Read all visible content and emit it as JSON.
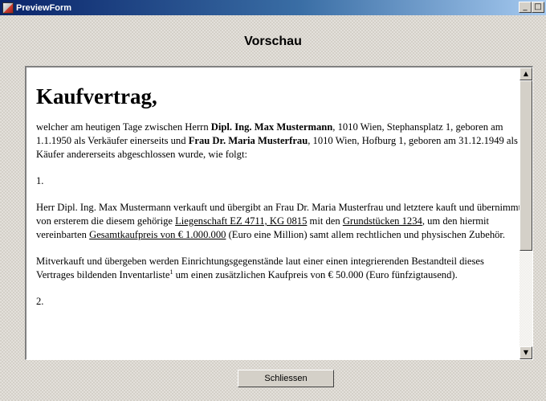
{
  "window": {
    "title": "PreviewForm",
    "controls": {
      "minimize": "_",
      "maximize": "□"
    }
  },
  "page": {
    "title": "Vorschau"
  },
  "document": {
    "heading": "Kaufvertrag,",
    "p1": {
      "a": "welcher am heutigen Tage zwischen Herrn ",
      "b": "Dipl. Ing. Max Mustermann",
      "c": ", 1010 Wien, Stephansplatz 1, geboren am 1.1.1950 als Verkäufer einerseits und ",
      "d": "Frau Dr. Maria Musterfrau",
      "e": ", 1010 Wien, Hofburg 1, geboren am 31.12.1949 als Käufer andererseits abgeschlossen wurde, wie folgt:"
    },
    "num1": "1.",
    "p2": {
      "a": "Herr Dipl. Ing. Max Mustermann verkauft und übergibt an Frau Dr. Maria Musterfrau und letztere kauft und übernimmt von ersterem die diesem gehörige ",
      "b": "Liegenschaft EZ 4711, KG 0815",
      "c": " mit den ",
      "d": "Grundstücken 1234",
      "e": ", um den hiermit vereinbarten ",
      "f": "Gesamtkaufpreis von € 1.000.000",
      "g": " (Euro eine Million) samt allem rechtlichen und physischen Zubehör."
    },
    "p3": {
      "a": "Mitverkauft und übergeben werden Einrichtungsgegenstände laut einer einen integrierenden Bestandteil dieses Vertrages bildenden Inventarliste",
      "sup": "1",
      "b": " um einen zusätzlichen Kaufpreis von € 50.000 (Euro fünfzigtausend)."
    },
    "num2": "2."
  },
  "scrollbar": {
    "up_arrow": "▲",
    "down_arrow": "▼"
  },
  "buttons": {
    "close_label": "Schliessen"
  }
}
